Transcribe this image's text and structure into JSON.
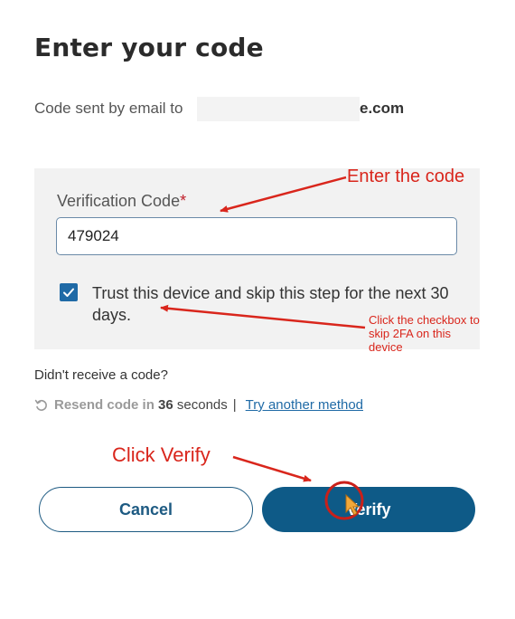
{
  "page": {
    "title": "Enter your code"
  },
  "email_notice": {
    "prefix": "Code sent by email to",
    "address_suffix": "e.com"
  },
  "verification": {
    "label": "Verification Code",
    "required_mark": "*",
    "value": "479024",
    "trust_checked": true,
    "trust_label": "Trust this device and skip this step for the next 30 days."
  },
  "resend": {
    "question": "Didn't receive a code?",
    "resend_label": "Resend code in",
    "countdown": "36",
    "seconds_label": "seconds",
    "separator": "|",
    "alt_method_link": "Try another method"
  },
  "actions": {
    "cancel_label": "Cancel",
    "verify_label": "Verify"
  },
  "annotations": {
    "enter_code": "Enter the code",
    "checkbox_hint": "Click the checkbox to skip 2FA on this device",
    "click_verify": "Click Verify"
  },
  "colors": {
    "accent": "#0e5a87",
    "checkbox": "#1f6aa6",
    "annotation_red": "#d9261c",
    "panel_bg": "#f2f2f2"
  },
  "icons": {
    "checkbox": "checkmark-icon",
    "resend": "refresh-icon",
    "cursor": "mouse-pointer-icon"
  }
}
